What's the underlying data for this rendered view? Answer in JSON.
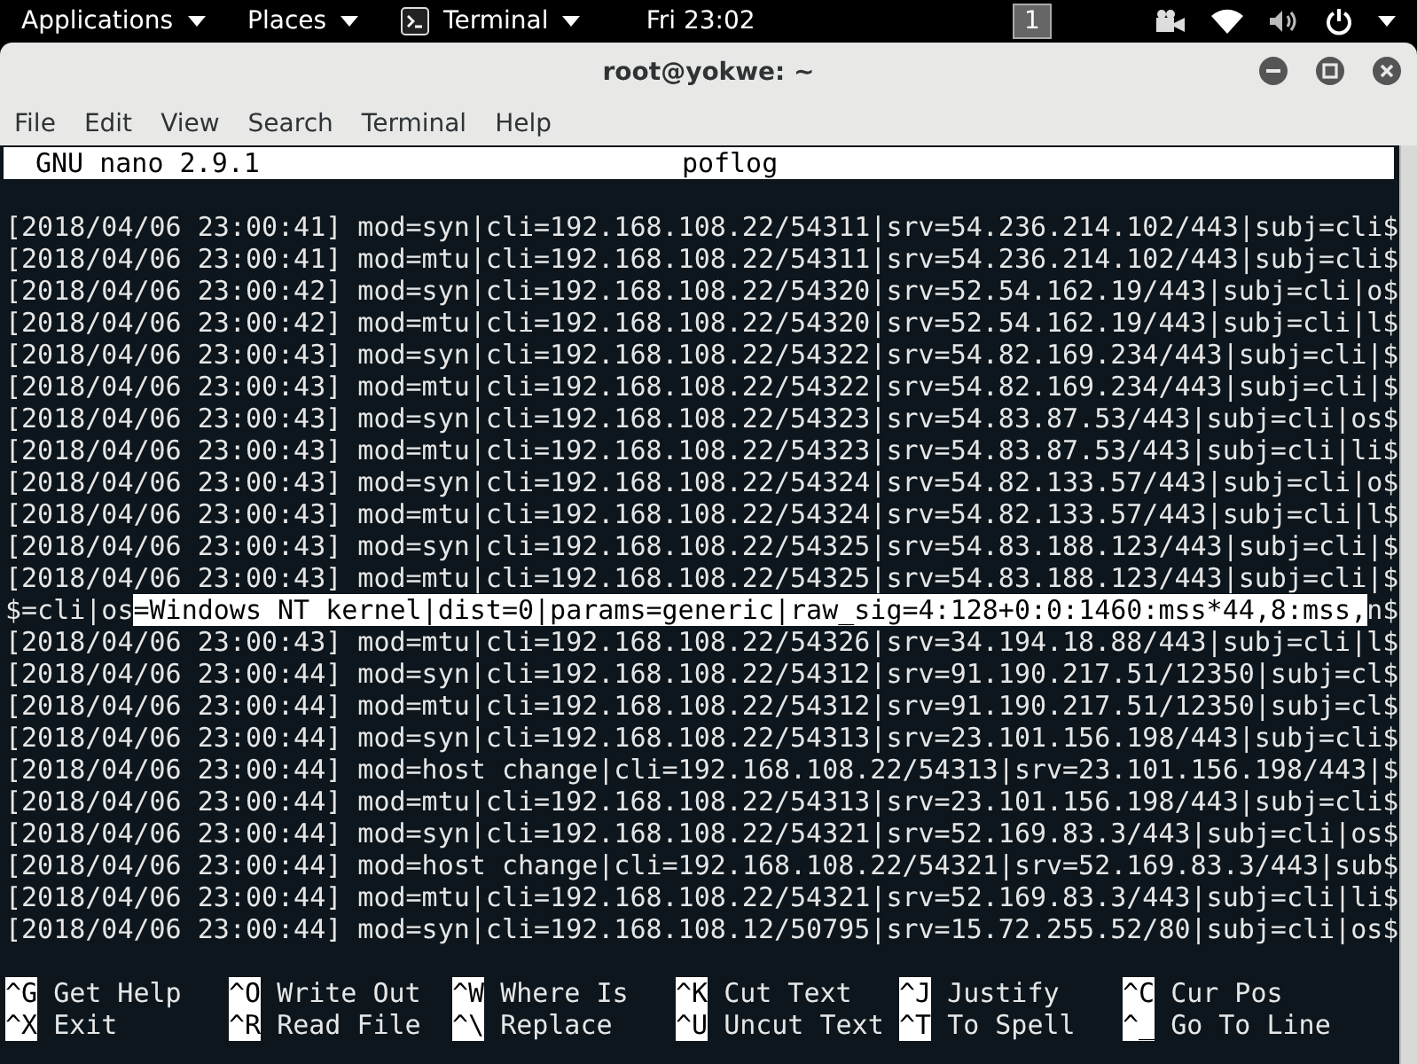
{
  "top_bar": {
    "applications": "Applications",
    "places": "Places",
    "app": "Terminal",
    "clock": "Fri 23:02",
    "workspace": "1"
  },
  "window": {
    "title": "root@yokwe: ~"
  },
  "menu": [
    "File",
    "Edit",
    "View",
    "Search",
    "Terminal",
    "Help"
  ],
  "nano": {
    "version": "GNU nano 2.9.1",
    "filename": "poflog"
  },
  "lines": [
    {
      "kind": "plain",
      "text": "[2018/04/06 23:00:41] mod=syn|cli=192.168.108.22/54311|srv=54.236.214.102/443|subj=cli$"
    },
    {
      "kind": "plain",
      "text": "[2018/04/06 23:00:41] mod=mtu|cli=192.168.108.22/54311|srv=54.236.214.102/443|subj=cli$"
    },
    {
      "kind": "plain",
      "text": "[2018/04/06 23:00:42] mod=syn|cli=192.168.108.22/54320|srv=52.54.162.19/443|subj=cli|o$"
    },
    {
      "kind": "plain",
      "text": "[2018/04/06 23:00:42] mod=mtu|cli=192.168.108.22/54320|srv=52.54.162.19/443|subj=cli|l$"
    },
    {
      "kind": "plain",
      "text": "[2018/04/06 23:00:43] mod=syn|cli=192.168.108.22/54322|srv=54.82.169.234/443|subj=cli|$"
    },
    {
      "kind": "plain",
      "text": "[2018/04/06 23:00:43] mod=mtu|cli=192.168.108.22/54322|srv=54.82.169.234/443|subj=cli|$"
    },
    {
      "kind": "plain",
      "text": "[2018/04/06 23:00:43] mod=syn|cli=192.168.108.22/54323|srv=54.83.87.53/443|subj=cli|os$"
    },
    {
      "kind": "plain",
      "text": "[2018/04/06 23:00:43] mod=mtu|cli=192.168.108.22/54323|srv=54.83.87.53/443|subj=cli|li$"
    },
    {
      "kind": "plain",
      "text": "[2018/04/06 23:00:43] mod=syn|cli=192.168.108.22/54324|srv=54.82.133.57/443|subj=cli|o$"
    },
    {
      "kind": "plain",
      "text": "[2018/04/06 23:00:43] mod=mtu|cli=192.168.108.22/54324|srv=54.82.133.57/443|subj=cli|l$"
    },
    {
      "kind": "plain",
      "text": "[2018/04/06 23:00:43] mod=syn|cli=192.168.108.22/54325|srv=54.83.188.123/443|subj=cli|$"
    },
    {
      "kind": "plain",
      "text": "[2018/04/06 23:00:43] mod=mtu|cli=192.168.108.22/54325|srv=54.83.188.123/443|subj=cli|$"
    },
    {
      "kind": "marked",
      "before": "$=cli|os",
      "selected": "=Windows NT kernel|dist=0|params=generic|raw_sig=4:128+0:0:1460:mss*44,8:mss,",
      "after": "n$"
    },
    {
      "kind": "plain",
      "text": "[2018/04/06 23:00:43] mod=mtu|cli=192.168.108.22/54326|srv=34.194.18.88/443|subj=cli|l$"
    },
    {
      "kind": "plain",
      "text": "[2018/04/06 23:00:44] mod=syn|cli=192.168.108.22/54312|srv=91.190.217.51/12350|subj=cl$"
    },
    {
      "kind": "plain",
      "text": "[2018/04/06 23:00:44] mod=mtu|cli=192.168.108.22/54312|srv=91.190.217.51/12350|subj=cl$"
    },
    {
      "kind": "plain",
      "text": "[2018/04/06 23:00:44] mod=syn|cli=192.168.108.22/54313|srv=23.101.156.198/443|subj=cli$"
    },
    {
      "kind": "plain",
      "text": "[2018/04/06 23:00:44] mod=host change|cli=192.168.108.22/54313|srv=23.101.156.198/443|$"
    },
    {
      "kind": "plain",
      "text": "[2018/04/06 23:00:44] mod=mtu|cli=192.168.108.22/54313|srv=23.101.156.198/443|subj=cli$"
    },
    {
      "kind": "plain",
      "text": "[2018/04/06 23:00:44] mod=syn|cli=192.168.108.22/54321|srv=52.169.83.3/443|subj=cli|os$"
    },
    {
      "kind": "plain",
      "text": "[2018/04/06 23:00:44] mod=host change|cli=192.168.108.22/54321|srv=52.169.83.3/443|sub$"
    },
    {
      "kind": "plain",
      "text": "[2018/04/06 23:00:44] mod=mtu|cli=192.168.108.22/54321|srv=52.169.83.3/443|subj=cli|li$"
    },
    {
      "kind": "plain",
      "text": "[2018/04/06 23:00:44] mod=syn|cli=192.168.108.12/50795|srv=15.72.255.52/80|subj=cli|os$"
    }
  ],
  "shortcuts": [
    {
      "key": "^G",
      "label": "Get Help"
    },
    {
      "key": "^O",
      "label": "Write Out"
    },
    {
      "key": "^W",
      "label": "Where Is"
    },
    {
      "key": "^K",
      "label": "Cut Text"
    },
    {
      "key": "^J",
      "label": "Justify"
    },
    {
      "key": "^C",
      "label": "Cur Pos"
    },
    {
      "key": "^X",
      "label": "Exit"
    },
    {
      "key": "^R",
      "label": "Read File"
    },
    {
      "key": "^\\",
      "label": "Replace"
    },
    {
      "key": "^U",
      "label": "Uncut Text"
    },
    {
      "key": "^T",
      "label": "To Spell"
    },
    {
      "key": "^_",
      "label": "Go To Line"
    }
  ]
}
